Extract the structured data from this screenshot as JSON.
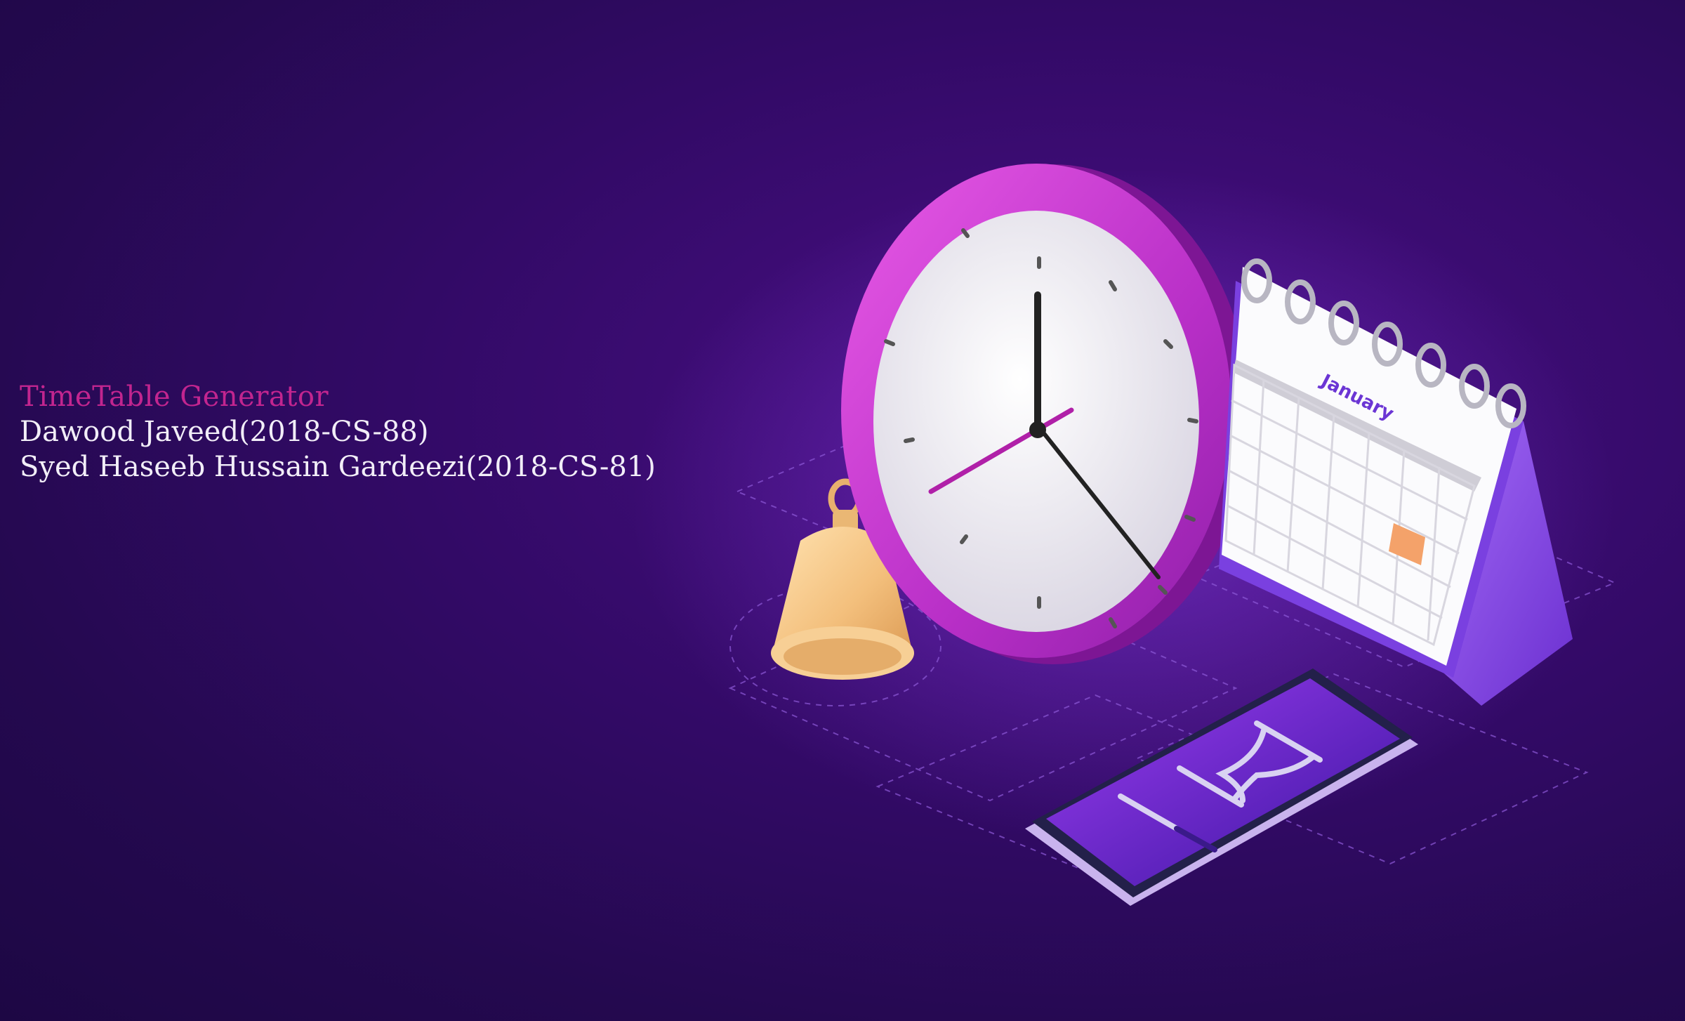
{
  "splash": {
    "title": "TimeTable Generator",
    "authors": [
      "Dawood Javeed(2018-CS-88)",
      "Syed Haseeb Hussain Gardeezi(2018-CS-81)"
    ]
  },
  "illustration": {
    "calendar_month": "January",
    "icons": [
      "clock-icon",
      "calendar-icon",
      "bell-icon",
      "phone-icon",
      "hourglass-icon"
    ]
  },
  "colors": {
    "background": "#2a0a5c",
    "title": "#c2258f",
    "text": "#f2eef8",
    "clock_rim": "#c93bd6",
    "calendar_stand": "#8b55ec",
    "bell": "#f5c88a"
  }
}
